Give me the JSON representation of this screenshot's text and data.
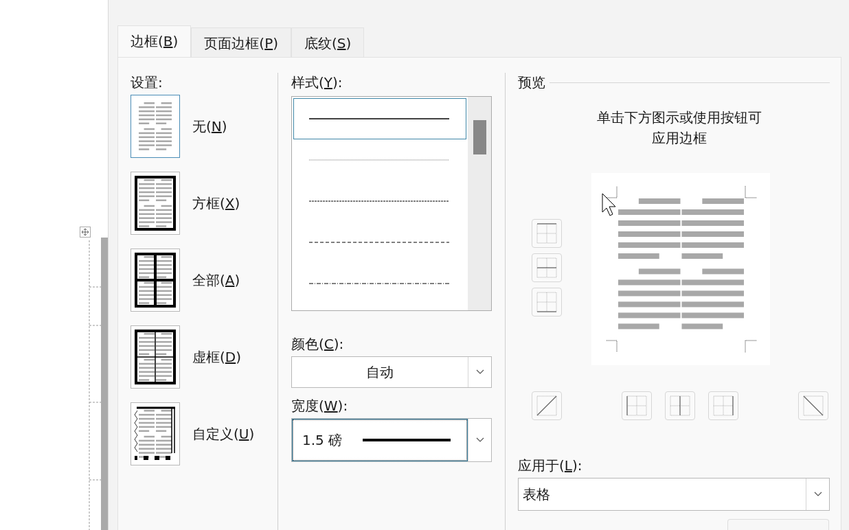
{
  "dialog": {
    "tabs": [
      {
        "label": "边框(",
        "access_key": "B",
        "label_end": ")",
        "selected": true
      },
      {
        "label": "页面边框(",
        "access_key": "P",
        "label_end": ")",
        "selected": false
      },
      {
        "label": "底纹(",
        "access_key": "S",
        "label_end": ")",
        "selected": false
      }
    ],
    "settings": {
      "label": "设置:",
      "items": [
        {
          "kind": "none",
          "label": "无(",
          "access_key": "N",
          "label_end": ")",
          "selected": true
        },
        {
          "kind": "box",
          "label": "方框(",
          "access_key": "X",
          "label_end": ")",
          "selected": false
        },
        {
          "kind": "all",
          "label": "全部(",
          "access_key": "A",
          "label_end": ")",
          "selected": false
        },
        {
          "kind": "grid",
          "label": "虚框(",
          "access_key": "D",
          "label_end": ")",
          "selected": false
        },
        {
          "kind": "custom",
          "label": "自定义(",
          "access_key": "U",
          "label_end": ")",
          "selected": false
        }
      ]
    },
    "style": {
      "label": "样式(",
      "access_key": "Y",
      "label_end": "):",
      "items": [
        {
          "kind": "solid",
          "selected": true
        },
        {
          "kind": "dotted",
          "selected": false
        },
        {
          "kind": "fine-dashed",
          "selected": false
        },
        {
          "kind": "dashed",
          "selected": false
        },
        {
          "kind": "dash-dot",
          "selected": false
        }
      ]
    },
    "color": {
      "label": "颜色(",
      "access_key": "C",
      "label_end": "):",
      "value": "自动"
    },
    "width": {
      "label": "宽度(",
      "access_key": "W",
      "label_end": "):",
      "value": "1.5 磅"
    },
    "preview": {
      "heading": "预览",
      "instruction_lines": [
        "单击下方图示或使用按钮可",
        "应用边框"
      ],
      "side_buttons": [
        {
          "kind": "top"
        },
        {
          "kind": "inside-h"
        },
        {
          "kind": "bottom"
        }
      ],
      "bottom_buttons": [
        {
          "kind": "diagonal-up"
        },
        {
          "kind": "left"
        },
        {
          "kind": "inside-v"
        },
        {
          "kind": "right"
        },
        {
          "kind": "diagonal-down"
        }
      ]
    },
    "apply_to": {
      "label": "应用于(",
      "access_key": "L",
      "label_end": "):",
      "value": "表格"
    }
  }
}
